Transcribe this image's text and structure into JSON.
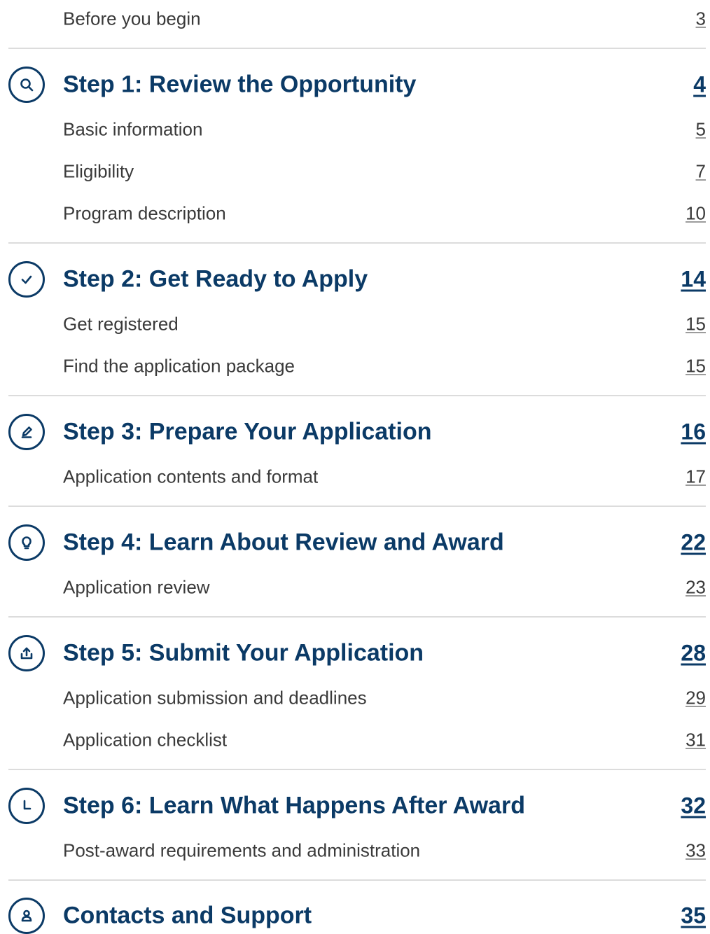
{
  "toc": {
    "before": {
      "title": "Before you begin",
      "page": "3"
    },
    "steps": [
      {
        "icon": "search-icon",
        "title": "Step 1: Review the Opportunity",
        "page": "4",
        "subs": [
          {
            "title": "Basic information",
            "page": "5"
          },
          {
            "title": "Eligibility",
            "page": "7"
          },
          {
            "title": "Program description",
            "page": "10"
          }
        ]
      },
      {
        "icon": "check-circle-icon",
        "title": "Step 2: Get Ready to Apply",
        "page": "14",
        "subs": [
          {
            "title": "Get registered",
            "page": "15"
          },
          {
            "title": "Find the application package",
            "page": "15"
          }
        ]
      },
      {
        "icon": "pencil-icon",
        "title": "Step 3: Prepare Your Application",
        "page": "16",
        "subs": [
          {
            "title": "Application contents and format",
            "page": "17"
          }
        ]
      },
      {
        "icon": "lightbulb-icon",
        "title": "Step 4: Learn About Review and Award",
        "page": "22",
        "subs": [
          {
            "title": "Application review",
            "page": "23"
          }
        ]
      },
      {
        "icon": "upload-icon",
        "title": "Step 5: Submit Your Application",
        "page": "28",
        "subs": [
          {
            "title": "Application submission and deadlines",
            "page": "29"
          },
          {
            "title": "Application checklist",
            "page": "31"
          }
        ]
      },
      {
        "icon": "clock-icon",
        "title": "Step 6: Learn What Happens After Award",
        "page": "32",
        "subs": [
          {
            "title": "Post-award requirements and administration",
            "page": "33"
          }
        ]
      },
      {
        "icon": "person-icon",
        "title": "Contacts and Support",
        "page": "35",
        "subs": []
      }
    ]
  },
  "colors": {
    "heading": "#0b3a66",
    "text": "#3a3a3a",
    "divider": "#dcdcdc"
  }
}
